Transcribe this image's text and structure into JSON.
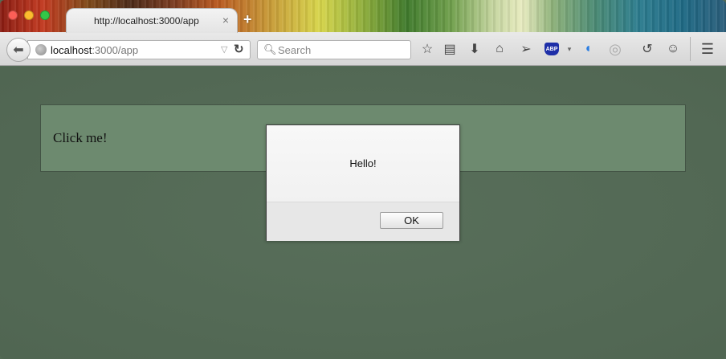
{
  "browser": {
    "tab_title": "http://localhost:3000/app",
    "tab_close": "×",
    "new_tab": "+",
    "url_host": "localhost",
    "url_path": ":3000/app",
    "search_placeholder": "Search",
    "toolbar_icons": [
      "bookmark-star-icon",
      "reading-list-icon",
      "download-icon",
      "home-icon",
      "send-icon",
      "adblock-icon",
      "vpn-icon",
      "circle-extension-icon",
      "history-icon",
      "smiley-icon",
      "menu-icon"
    ],
    "adblock_text": "ABP"
  },
  "page": {
    "panel_text": "Click me!"
  },
  "dialog": {
    "message": "Hello!",
    "ok_label": "OK"
  },
  "colors": {
    "page_background": "#556c57",
    "panel_background": "#6d8a6f",
    "dialog_background": "#f6f6f6"
  }
}
